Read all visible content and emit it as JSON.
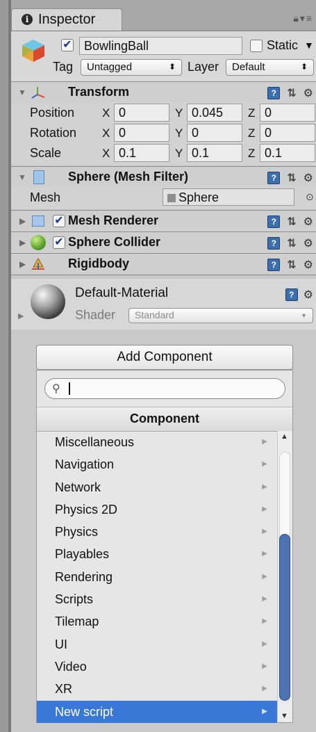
{
  "tab": {
    "title": "Inspector"
  },
  "object": {
    "active": true,
    "name": "BowlingBall",
    "static_label": "Static",
    "static_checked": false,
    "tag_label": "Tag",
    "tag_value": "Untagged",
    "layer_label": "Layer",
    "layer_value": "Default"
  },
  "transform": {
    "title": "Transform",
    "rows": [
      {
        "label": "Position",
        "x": "0",
        "y": "0.045",
        "z": "0"
      },
      {
        "label": "Rotation",
        "x": "0",
        "y": "0",
        "z": "0"
      },
      {
        "label": "Scale",
        "x": "0.1",
        "y": "0.1",
        "z": "0.1"
      }
    ],
    "axis_x": "X",
    "axis_y": "Y",
    "axis_z": "Z"
  },
  "mesh_filter": {
    "title": "Sphere (Mesh Filter)",
    "mesh_label": "Mesh",
    "mesh_value": "Sphere"
  },
  "components": [
    {
      "title": "Mesh Renderer",
      "checked": true
    },
    {
      "title": "Sphere Collider",
      "checked": true
    },
    {
      "title": "Rigidbody",
      "checked": false
    }
  ],
  "material": {
    "name": "Default-Material",
    "shader_label": "Shader",
    "shader_value": "Standard"
  },
  "add_component": {
    "button_label": "Add Component",
    "search_value": "",
    "header": "Component",
    "items": [
      "Miscellaneous",
      "Navigation",
      "Network",
      "Physics 2D",
      "Physics",
      "Playables",
      "Rendering",
      "Scripts",
      "Tilemap",
      "UI",
      "Video",
      "XR",
      "New script"
    ],
    "selected": "New script"
  },
  "colors": {
    "selection": "#3a78d8",
    "scroll_thumb": "#4d73b3",
    "icon_blue": "#3c6fb0"
  }
}
